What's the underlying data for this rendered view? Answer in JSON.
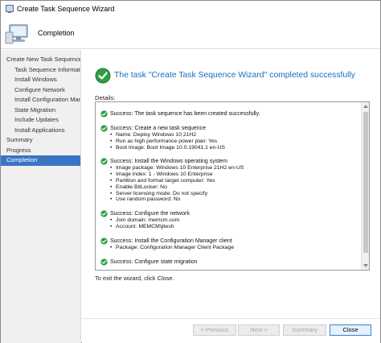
{
  "window": {
    "title": "Create Task Sequence Wizard"
  },
  "header": {
    "title": "Completion"
  },
  "sidebar": {
    "items": [
      {
        "label": "Create New Task Sequence",
        "level": 0,
        "active": false
      },
      {
        "label": "Task Sequence Informatic",
        "level": 1,
        "active": false
      },
      {
        "label": "Install Windows",
        "level": 1,
        "active": false
      },
      {
        "label": "Configure Network",
        "level": 1,
        "active": false
      },
      {
        "label": "Install Configuration Mar",
        "level": 1,
        "active": false
      },
      {
        "label": "State Migration",
        "level": 1,
        "active": false
      },
      {
        "label": "Include Updates",
        "level": 1,
        "active": false
      },
      {
        "label": "Install Applications",
        "level": 1,
        "active": false
      },
      {
        "label": "Summary",
        "level": 0,
        "active": false
      },
      {
        "label": "Progress",
        "level": 0,
        "active": false
      },
      {
        "label": "Completion",
        "level": 0,
        "active": true
      }
    ]
  },
  "main": {
    "status_message": "The task \"Create Task Sequence Wizard\" completed successfully",
    "details_label": "Details:",
    "details": [
      {
        "head": "Success: The task sequence has been created successfully.",
        "lines": []
      },
      {
        "head": "Success: Create a new task sequence",
        "lines": [
          "Name: Deploy Windows 10 21H2",
          "Run as high performance power plan: Yes",
          "Boot Image: Boot Image 10.0.19041.1 en-US"
        ]
      },
      {
        "head": "Success: Install the Windows operating system",
        "lines": [
          "Image package: Windows 10 Enterprise 21H2 en-US",
          "Image index: 1 - Windows 10 Enterprise",
          "Partition and format target computer: Yes",
          "Enable BitLocker: No",
          "Server licensing mode: Do not specify",
          "Use random password: No"
        ]
      },
      {
        "head": "Success: Configure the network",
        "lines": [
          "Join domain: memcm.com",
          "Account: MEMCM\\jitesh"
        ]
      },
      {
        "head": "Success: Install the Configuration Manager client",
        "lines": [
          "Package: Configuration Manager Client Package"
        ]
      },
      {
        "head": "Success: Configure state migration",
        "lines": []
      }
    ],
    "exit_text": "To exit the wizard, click Close."
  },
  "buttons": {
    "previous": "< Previous",
    "next": "Next >",
    "summary": "Summary",
    "close": "Close"
  },
  "colors": {
    "accent": "#3a75c4",
    "status_text": "#1a6ebd",
    "success_green": "#2ea043"
  }
}
